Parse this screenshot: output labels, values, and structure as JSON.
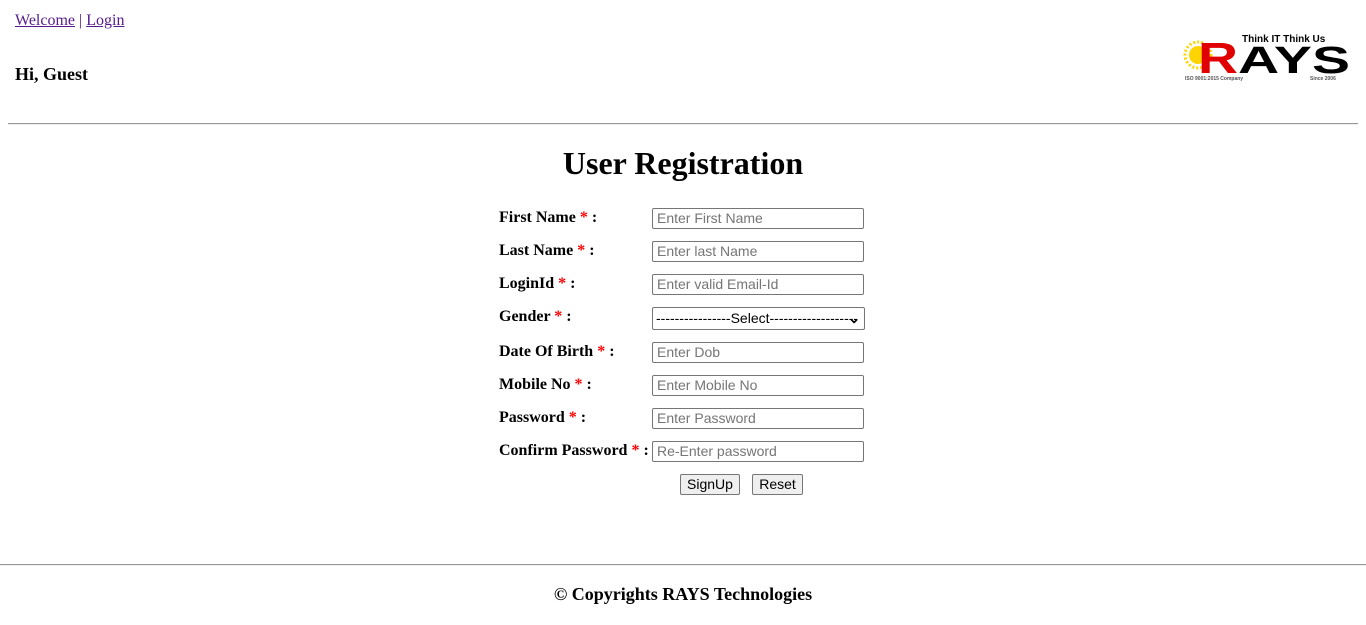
{
  "nav": {
    "welcome": "Welcome",
    "separator": "|",
    "login": "Login"
  },
  "greeting": "Hi, Guest",
  "logo": {
    "brand": "RAYS",
    "tagline": "Think IT Think Us",
    "iso": "ISO 9001:2015 Company",
    "since": "Since 2006"
  },
  "title": "User Registration",
  "required_mark": "*",
  "fields": [
    {
      "label": "First Name",
      "placeholder": "Enter First Name"
    },
    {
      "label": "Last Name",
      "placeholder": "Enter last Name"
    },
    {
      "label": "LoginId",
      "placeholder": "Enter valid Email-Id"
    },
    {
      "label": "Gender",
      "selected": "----------------Select-------------------"
    },
    {
      "label": "Date Of Birth",
      "placeholder": "Enter Dob"
    },
    {
      "label": "Mobile No",
      "placeholder": "Enter Mobile No"
    },
    {
      "label": "Password",
      "placeholder": "Enter Password"
    },
    {
      "label": "Confirm Password",
      "placeholder": "Re-Enter password"
    }
  ],
  "buttons": {
    "signup": "SignUp",
    "reset": "Reset"
  },
  "footer": "© Copyrights RAYS Technologies"
}
